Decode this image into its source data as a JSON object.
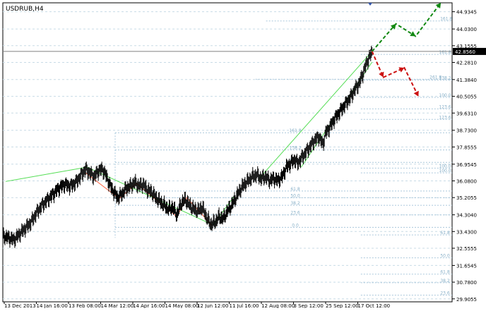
{
  "chart_data": {
    "type": "candlestick",
    "title": "USDRUB,H4",
    "x_tick_labels": [
      "13 Dec 2013",
      "14 Jan 16:00",
      "13 Feb 08:00",
      "14 Mar 12:00",
      "14 Apr 16:00",
      "14 May 08:00",
      "12 Jun 12:00",
      "11 Jul 16:00",
      "12 Aug 08:00",
      "3 Sep 12:00",
      "25 Sep 12:00",
      "17 Oct 12:00"
    ],
    "y_ticks": [
      44.9345,
      44.03,
      43.1555,
      42.281,
      41.384,
      40.5055,
      39.631,
      38.73,
      37.8555,
      36.9545,
      36.08,
      35.2055,
      34.304,
      33.43,
      32.5555,
      31.6545,
      30.78,
      29.9055
    ],
    "ylim": [
      29.75,
      45.4
    ],
    "current_price": 42.856,
    "current_price_label": "42.8560",
    "price_series": [
      [
        0,
        33.2
      ],
      [
        8,
        33.1
      ],
      [
        16,
        33.0
      ],
      [
        24,
        33.3
      ],
      [
        32,
        33.6
      ],
      [
        40,
        33.9
      ],
      [
        48,
        34.4
      ],
      [
        56,
        34.8
      ],
      [
        64,
        35.1
      ],
      [
        72,
        35.4
      ],
      [
        80,
        35.7
      ],
      [
        88,
        35.9
      ],
      [
        96,
        35.8
      ],
      [
        104,
        36.0
      ],
      [
        112,
        36.4
      ],
      [
        118,
        36.7
      ],
      [
        124,
        36.5
      ],
      [
        130,
        36.3
      ],
      [
        136,
        36.6
      ],
      [
        142,
        36.7
      ],
      [
        148,
        36.3
      ],
      [
        152,
        35.9
      ],
      [
        158,
        35.5
      ],
      [
        164,
        35.2
      ],
      [
        170,
        35.4
      ],
      [
        176,
        35.7
      ],
      [
        182,
        35.8
      ],
      [
        188,
        36.0
      ],
      [
        194,
        35.8
      ],
      [
        200,
        35.9
      ],
      [
        206,
        35.6
      ],
      [
        212,
        35.5
      ],
      [
        218,
        35.2
      ],
      [
        224,
        35.0
      ],
      [
        230,
        34.8
      ],
      [
        236,
        34.6
      ],
      [
        242,
        34.7
      ],
      [
        248,
        34.3
      ],
      [
        254,
        34.9
      ],
      [
        260,
        35.1
      ],
      [
        266,
        34.8
      ],
      [
        272,
        34.6
      ],
      [
        278,
        34.5
      ],
      [
        284,
        34.7
      ],
      [
        290,
        34.2
      ],
      [
        296,
        33.8
      ],
      [
        302,
        33.9
      ],
      [
        308,
        34.2
      ],
      [
        314,
        34.1
      ],
      [
        320,
        34.5
      ],
      [
        326,
        34.8
      ],
      [
        332,
        35.2
      ],
      [
        338,
        35.6
      ],
      [
        344,
        35.9
      ],
      [
        350,
        36.1
      ],
      [
        356,
        36.3
      ],
      [
        362,
        36.4
      ],
      [
        368,
        36.2
      ],
      [
        374,
        36.3
      ],
      [
        380,
        36.1
      ],
      [
        386,
        36.2
      ],
      [
        392,
        36.1
      ],
      [
        398,
        36.3
      ],
      [
        404,
        36.8
      ],
      [
        410,
        37.0
      ],
      [
        416,
        37.2
      ],
      [
        420,
        37.0
      ],
      [
        426,
        37.3
      ],
      [
        432,
        37.6
      ],
      [
        438,
        37.9
      ],
      [
        444,
        38.2
      ],
      [
        450,
        38.4
      ],
      [
        456,
        38.0
      ],
      [
        460,
        38.6
      ],
      [
        466,
        38.9
      ],
      [
        472,
        39.3
      ],
      [
        478,
        39.6
      ],
      [
        484,
        39.9
      ],
      [
        490,
        40.2
      ],
      [
        496,
        40.5
      ],
      [
        502,
        40.9
      ],
      [
        508,
        41.2
      ],
      [
        514,
        41.8
      ],
      [
        520,
        42.4
      ],
      [
        526,
        42.856
      ]
    ],
    "levels": [
      {
        "label": "161.8",
        "value": 44.45,
        "x_start": 375
      },
      {
        "label": "161.8",
        "value": 42.7,
        "x_start": 510
      },
      {
        "label": "261.8",
        "value": 41.4,
        "x_start": 360
      },
      {
        "label": "138.2",
        "value": 41.35,
        "x_start": 510
      },
      {
        "label": "100.0",
        "value": 40.45,
        "x_start": 510
      },
      {
        "label": "123.6",
        "value": 39.85,
        "x_start": 510
      },
      {
        "label": "123.6",
        "value": 39.3,
        "x_start": 510
      },
      {
        "label": "161.8",
        "value": 38.6,
        "x_start": 160
      },
      {
        "label": "138.2",
        "value": 37.7,
        "x_start": 160
      },
      {
        "label": "100.0",
        "value": 37.05,
        "x_start": 160
      },
      {
        "label": "100.0",
        "value": 36.75,
        "x_start": 510
      },
      {
        "label": "100.0",
        "value": 36.5,
        "x_start": 510
      },
      {
        "label": "61.8",
        "value": 35.55,
        "x_start": 160
      },
      {
        "label": "50.0",
        "value": 35.2,
        "x_start": 160
      },
      {
        "label": "38.2",
        "value": 34.8,
        "x_start": 160
      },
      {
        "label": "23.6",
        "value": 34.3,
        "x_start": 160
      },
      {
        "label": "0.0",
        "value": 33.65,
        "x_start": 160
      },
      {
        "label": "61.8",
        "value": 33.25,
        "x_start": 510
      },
      {
        "label": "50.0",
        "value": 32.05,
        "x_start": 510
      },
      {
        "label": "61.8",
        "value": 31.2,
        "x_start": 510
      },
      {
        "label": "38.2",
        "value": 30.75,
        "x_start": 510
      },
      {
        "label": "23.6",
        "value": 30.1,
        "x_start": 510
      }
    ],
    "trend_lines": [
      {
        "color": "#55dd55",
        "points": [
          [
            4,
            36.05
          ],
          [
            120,
            36.8
          ]
        ]
      },
      {
        "color": "#55dd55",
        "points": [
          [
            120,
            36.8
          ],
          [
            298,
            33.8
          ]
        ]
      },
      {
        "color": "#55dd55",
        "points": [
          [
            365,
            36.2
          ],
          [
            526,
            42.856
          ]
        ]
      },
      {
        "color": "#55dd55",
        "points": [
          [
            425,
            36.8
          ],
          [
            526,
            42.3
          ]
        ]
      },
      {
        "color": "#55dd55",
        "points": [
          [
            300,
            33.8
          ],
          [
            330,
            35.3
          ]
        ]
      }
    ],
    "zigzag": [
      [
        118,
        36.5
      ],
      [
        166,
        35.15
      ],
      [
        190,
        35.95
      ],
      [
        248,
        34.2
      ],
      [
        262,
        35.2
      ],
      [
        298,
        33.75
      ]
    ],
    "zigzag_color": "#ff6644",
    "forecast_up": {
      "color": "#118811",
      "points": [
        [
          526,
          42.856
        ],
        [
          560,
          44.3
        ],
        [
          588,
          43.65
        ],
        [
          624,
          45.4
        ]
      ]
    },
    "forecast_down": {
      "color": "#cc1111",
      "points": [
        [
          526,
          42.856
        ],
        [
          542,
          41.5
        ],
        [
          572,
          42.0
        ],
        [
          592,
          40.5
        ]
      ]
    }
  }
}
